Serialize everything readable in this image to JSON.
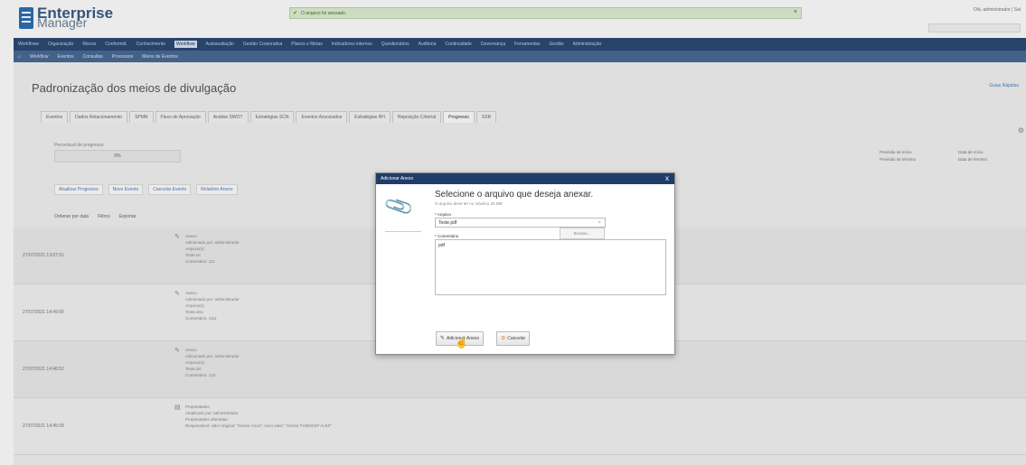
{
  "app": {
    "logo_line1": "Enterprise",
    "logo_line2": "Manager"
  },
  "toast": {
    "message": "O arquivo foi anexado.",
    "close": "×"
  },
  "user": {
    "info": "Olá, administrador | Sai"
  },
  "menu": {
    "items": [
      "Workflows",
      "Organização",
      "Riscos",
      "Conformid.",
      "Conhecimento",
      "Workflow",
      "Autoavaliação",
      "Gestão Corporativa",
      "Planos e Metas",
      "Indicadores internos",
      "Questionários",
      "Auditoria",
      "Continuidade",
      "Governança",
      "Ferramentas",
      "Gestão",
      "Administração"
    ],
    "active_index": 5
  },
  "submenu": {
    "items": [
      "Workflow",
      "Eventos",
      "Consultas",
      "Processos",
      "Meios de Eventos"
    ]
  },
  "page": {
    "title": "Padronização dos meios de divulgação",
    "help": "Guias Rápidas"
  },
  "tabs": {
    "items": [
      "Eventos",
      "Dados Relacionamento",
      "SPMN",
      "Fluxo de Aprovação",
      "Análise SWOT",
      "Estratégias SCN",
      "Eventos Associados",
      "Estratégias RH",
      "Reposição Criterial",
      "Progresso",
      "SSR"
    ],
    "active_index": 9
  },
  "progress_field": {
    "label": "Percentual de progresso",
    "value": "0%"
  },
  "right_info": {
    "label_a": "Previsão de início",
    "label_b": "Previsão de término",
    "value_a": "Data de início",
    "value_b": "Data de término"
  },
  "toolbar": {
    "items": [
      "Atualizar Progresso",
      "Novo Evento",
      "Cancelar Evento",
      "Relatório Anexo"
    ]
  },
  "list_tools": {
    "sort": "Ordenar por data",
    "filter": "Filtros",
    "export": "Exportar"
  },
  "history": [
    {
      "time": "27/07/2021 13:07:51",
      "lines": [
        "Anexo",
        "Adicionado por: administrador",
        "Arquivo(s):",
        "Teste.txt",
        "Comentário: 111"
      ]
    },
    {
      "time": "27/07/2021 14:49:00",
      "lines": [
        "Anexo",
        "Adicionado por: administrador",
        "Arquivo(s):",
        "Teste.xlsx",
        "Comentário: 1111"
      ]
    },
    {
      "time": "27/07/2021 14:48:52",
      "lines": [
        "Anexo",
        "Adicionado por: administrador",
        "Arquivo(s):",
        "Teste.xls",
        "Comentário: 123"
      ]
    },
    {
      "time": "27/07/2021 14:45:09",
      "lines": [
        "Propriedades",
        "Atualizado por: administrador",
        "Propriedades alteradas:",
        "Responsável: valor original: \"Gestor Anon\"; novo valor: \"Gestor FUNDESP ALEF\""
      ]
    }
  ],
  "modal": {
    "header": "Adicionar Anexo",
    "close": "x",
    "title": "Selecione o arquivo que deseja anexar.",
    "subtitle": "O arquivo deve ter no máximo 20 MB",
    "file_label": "* Arquivo",
    "file_value": "Teste.pdf",
    "file_clear": "×",
    "browse": "Browse...",
    "comment_label": "* Comentário",
    "comment_value": "pdf",
    "add_button": "Adicionar Anexo",
    "cancel_button": "Cancelar"
  }
}
